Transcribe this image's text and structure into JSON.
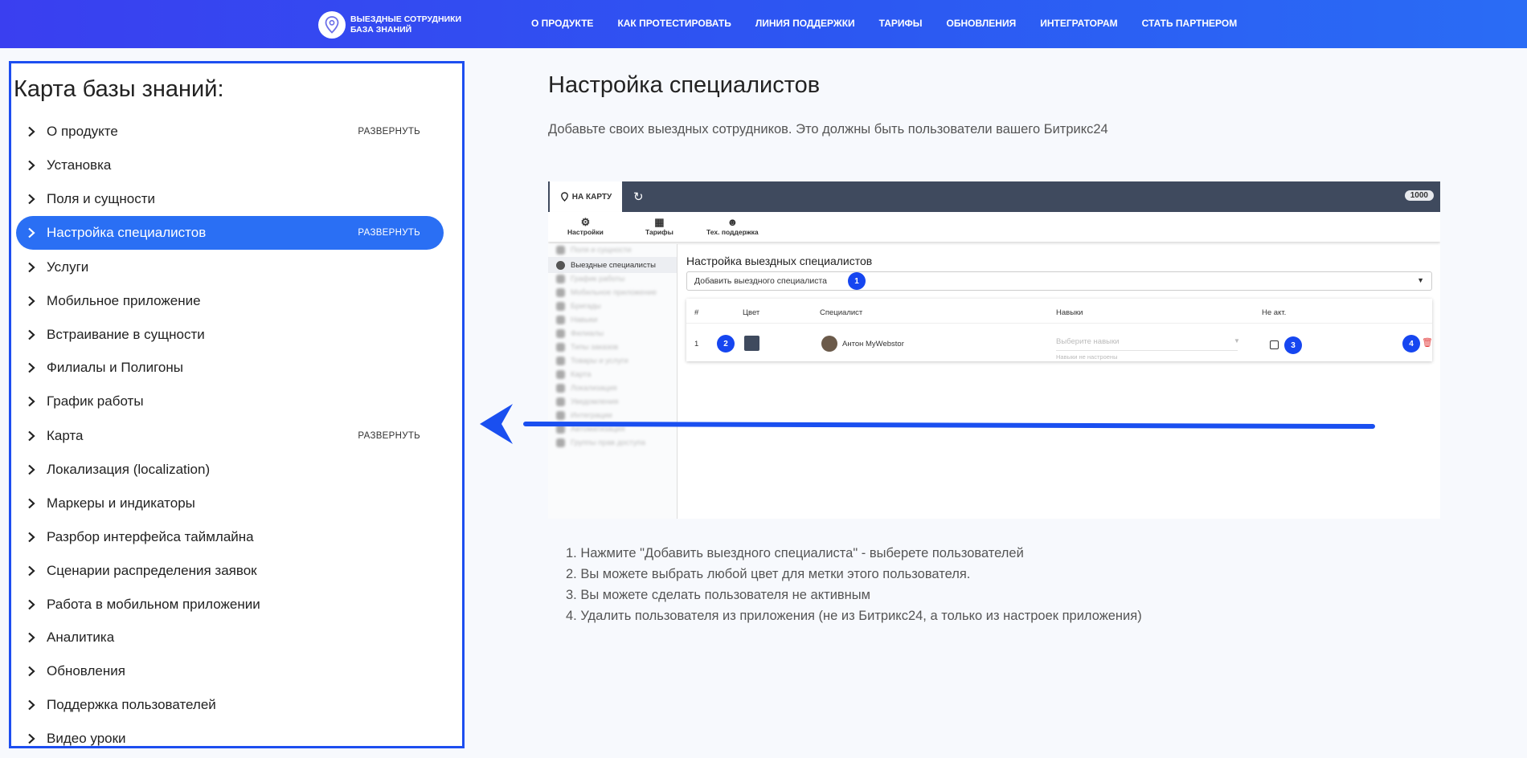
{
  "header": {
    "logo_line1": "ВЫЕЗДНЫЕ СОТРУДНИКИ",
    "logo_line2": "БАЗА ЗНАНИЙ",
    "nav": [
      "О ПРОДУКТЕ",
      "КАК ПРОТЕСТИРОВАТЬ",
      "ЛИНИЯ ПОДДЕРЖКИ",
      "ТАРИФЫ",
      "ОБНОВЛЕНИЯ",
      "ИНТЕГРАТОРАМ",
      "СТАТЬ ПАРТНЕРОМ"
    ]
  },
  "sidebar": {
    "title": "Карта базы знаний:",
    "expand_label": "РАЗВЕРНУТЬ",
    "items": [
      {
        "label": "О продукте",
        "expandable": true,
        "active": false
      },
      {
        "label": "Установка",
        "expandable": false,
        "active": false
      },
      {
        "label": "Поля и сущности",
        "expandable": false,
        "active": false
      },
      {
        "label": "Настройка специалистов",
        "expandable": true,
        "active": true
      },
      {
        "label": "Услуги",
        "expandable": false,
        "active": false
      },
      {
        "label": "Мобильное приложение",
        "expandable": false,
        "active": false
      },
      {
        "label": "Встраивание в сущности",
        "expandable": false,
        "active": false
      },
      {
        "label": "Филиалы и Полигоны",
        "expandable": false,
        "active": false
      },
      {
        "label": "График работы",
        "expandable": false,
        "active": false
      },
      {
        "label": "Карта",
        "expandable": true,
        "active": false
      },
      {
        "label": "Локализация (localization)",
        "expandable": false,
        "active": false
      },
      {
        "label": "Маркеры и индикаторы",
        "expandable": false,
        "active": false
      },
      {
        "label": "Разрбор интерфейса таймлайна",
        "expandable": false,
        "active": false
      },
      {
        "label": "Сценарии распределения заявок",
        "expandable": false,
        "active": false
      },
      {
        "label": "Работа в мобильном приложении",
        "expandable": false,
        "active": false
      },
      {
        "label": "Аналитика",
        "expandable": false,
        "active": false
      },
      {
        "label": "Обновления",
        "expandable": false,
        "active": false
      },
      {
        "label": "Поддержка пользователей",
        "expandable": false,
        "active": false
      },
      {
        "label": "Видео уроки",
        "expandable": false,
        "active": false
      }
    ]
  },
  "content": {
    "title": "Настройка специалистов",
    "description": "Добавьте своих выездных сотрудников. Это должны быть пользователи вашего Битрикс24",
    "screenshot": {
      "tab_label": "НА КАРТУ",
      "counter": "1000",
      "tools": [
        "Настройки",
        "Тарифы",
        "Тех. поддержка"
      ],
      "side_active": "Выездные специалисты",
      "heading": "Настройка выездных специалистов",
      "add_select": "Добавить выездного специалиста",
      "columns": [
        "#",
        "Цвет",
        "Специалист",
        "Навыки",
        "Не акт."
      ],
      "row": {
        "num": "1",
        "specialist": "Антон MyWebstor",
        "skills_placeholder": "Выберите навыки",
        "skills_hint": "Навыки не настроены"
      },
      "markers": [
        "1",
        "2",
        "3",
        "4"
      ]
    },
    "steps": [
      "1. Нажмите \"Добавить выездного специалиста\" - выберете пользователей",
      "2. Вы можете выбрать любой цвет для метки этого пользователя.",
      "3. Вы можете сделать пользователя не активным",
      "4. Удалить пользователя из приложения (не из Битрикс24, а только из настроек приложения)"
    ]
  },
  "colors": {
    "header_gradient_start": "#3a3ff0",
    "header_gradient_end": "#2a6cf5",
    "accent": "#2a6ff4",
    "sidebar_border": "#1d4ef0",
    "marker": "#1646f0",
    "arrow": "#1a4ff0"
  }
}
